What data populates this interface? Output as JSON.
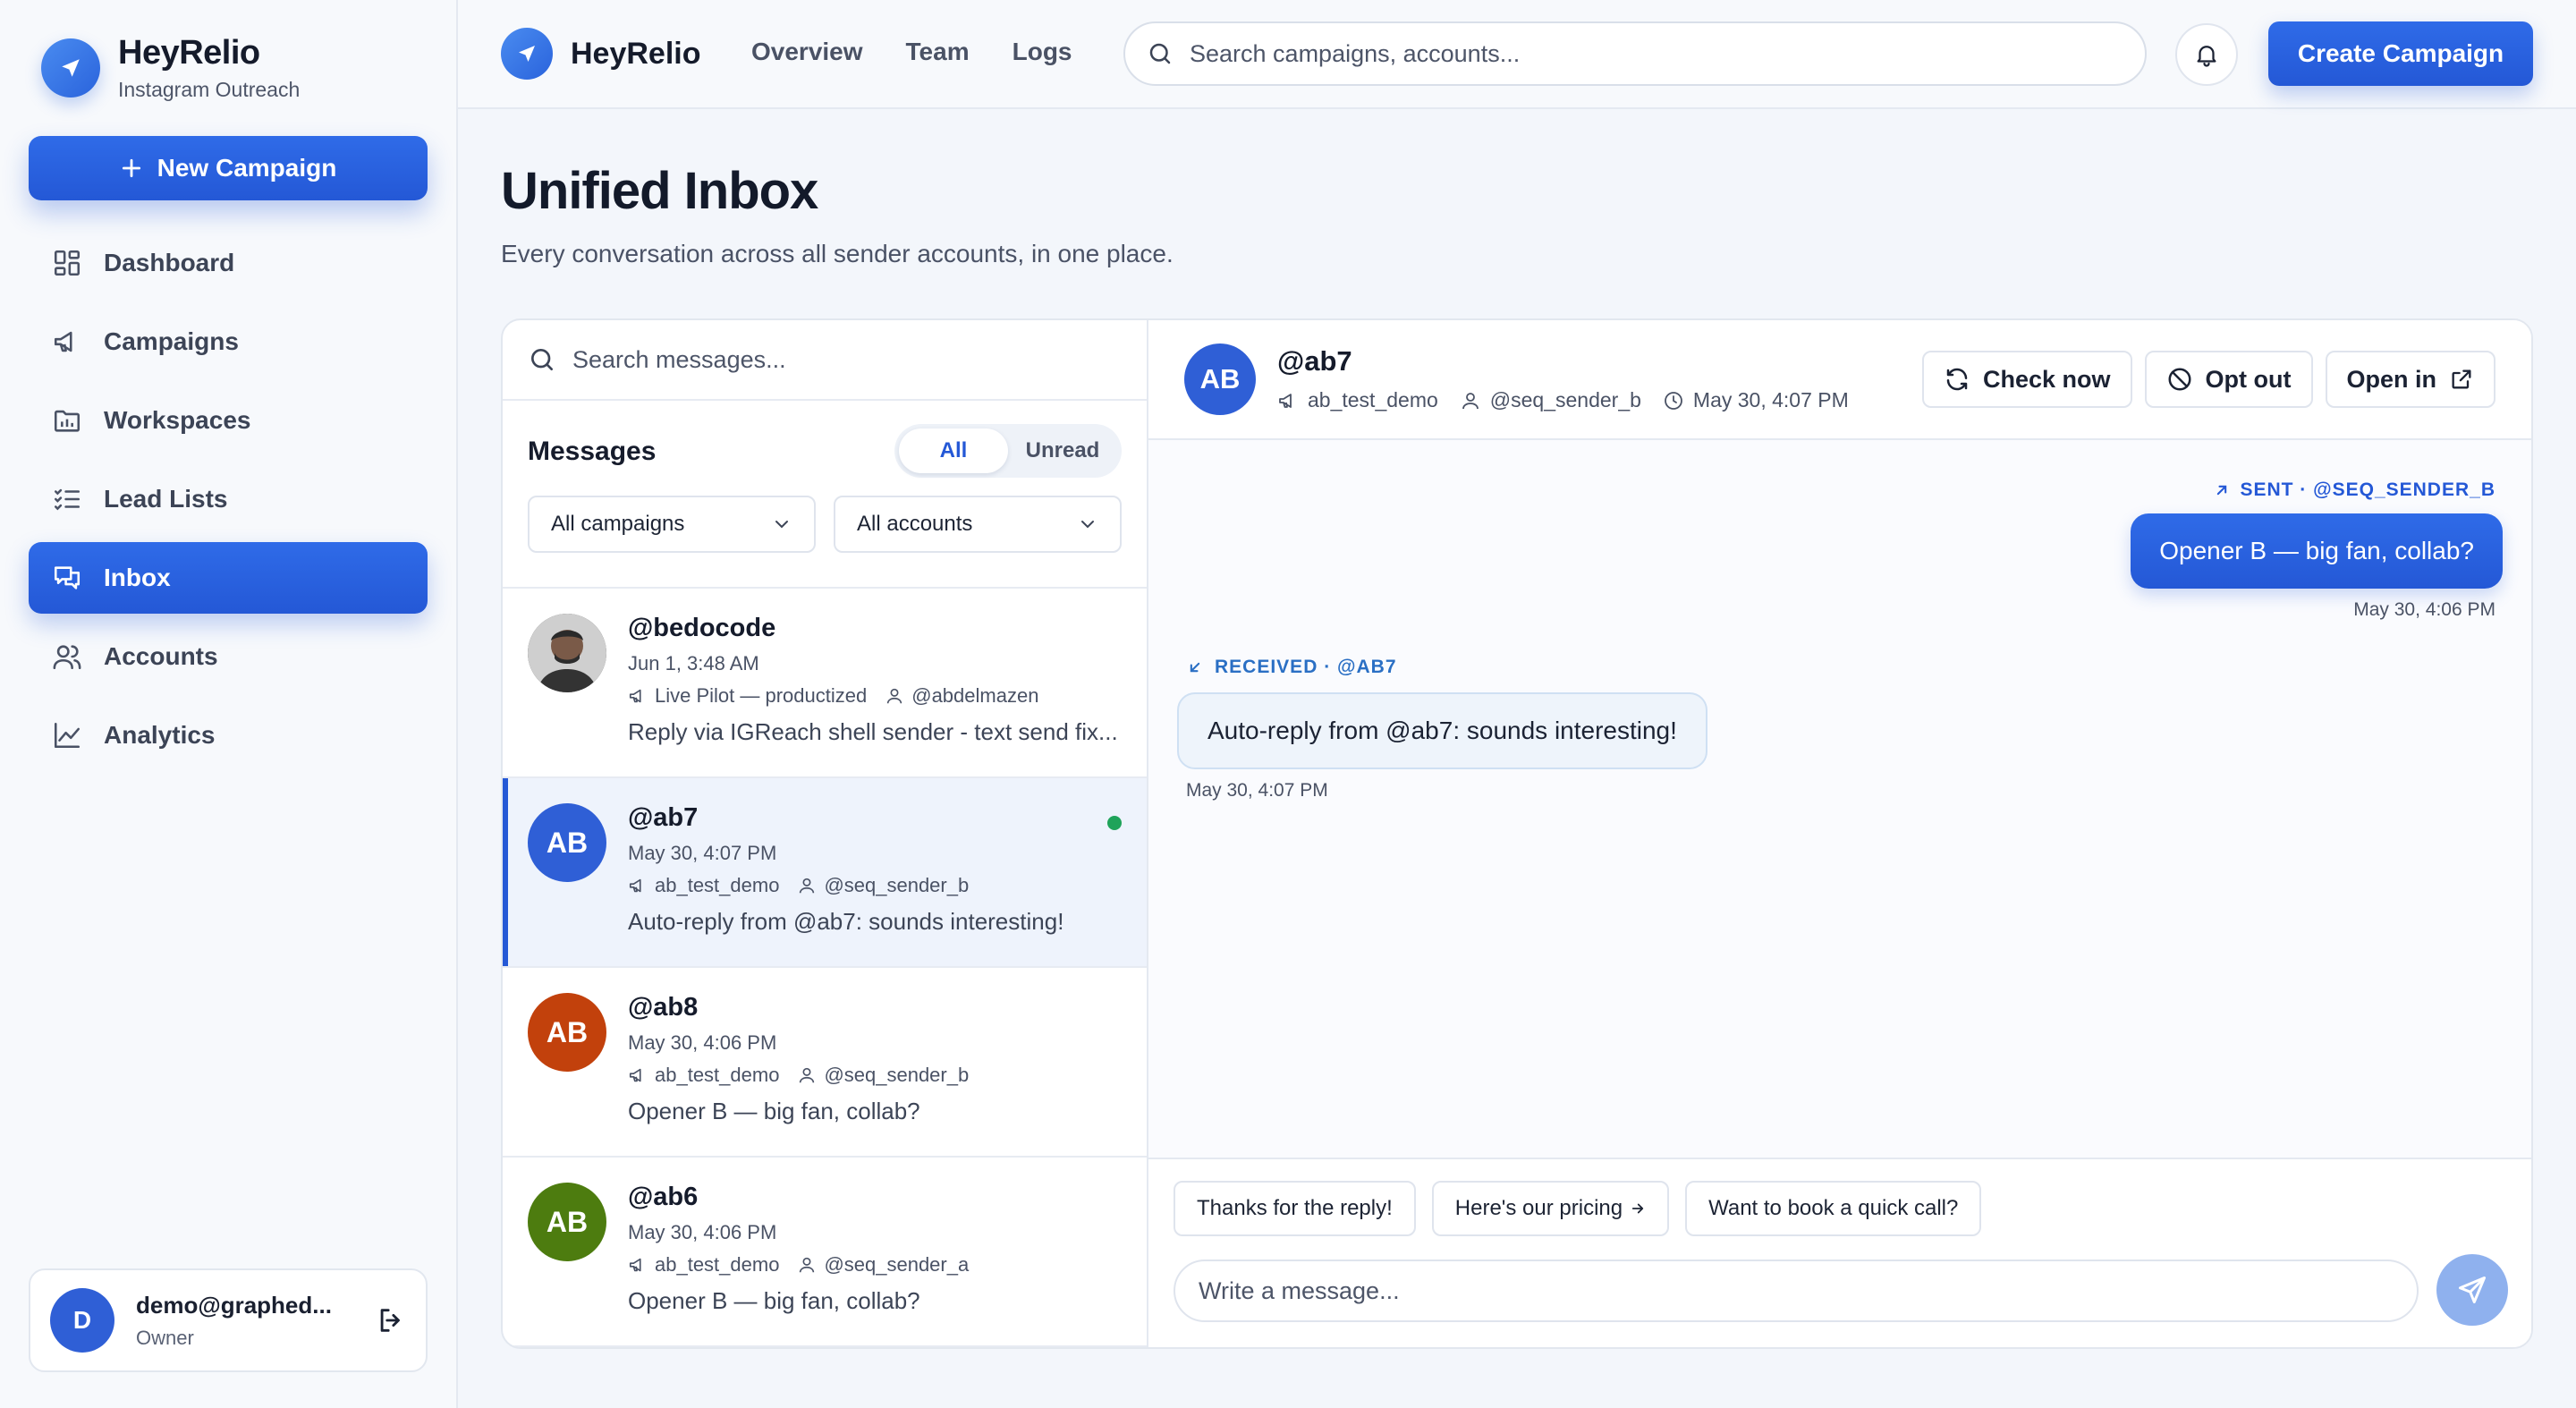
{
  "app": {
    "name": "HeyRelio",
    "tagline": "Instagram Outreach",
    "accent": "#2458d6"
  },
  "sidebar": {
    "new_campaign_label": "New Campaign",
    "items": [
      {
        "label": "Dashboard",
        "icon": "dashboard-icon",
        "active": false
      },
      {
        "label": "Campaigns",
        "icon": "megaphone-icon",
        "active": false
      },
      {
        "label": "Workspaces",
        "icon": "folder-icon",
        "active": false
      },
      {
        "label": "Lead Lists",
        "icon": "list-check-icon",
        "active": false
      },
      {
        "label": "Inbox",
        "icon": "chat-icon",
        "active": true
      },
      {
        "label": "Accounts",
        "icon": "users-icon",
        "active": false
      },
      {
        "label": "Analytics",
        "icon": "chart-line-icon",
        "active": false
      }
    ],
    "user": {
      "initial": "D",
      "email": "demo@graphed...",
      "role": "Owner"
    }
  },
  "topbar": {
    "brand": "HeyRelio",
    "links": [
      "Overview",
      "Team",
      "Logs"
    ],
    "search_placeholder": "Search campaigns, accounts...",
    "create_label": "Create Campaign"
  },
  "page": {
    "title": "Unified Inbox",
    "subtitle": "Every conversation across all sender accounts, in one place."
  },
  "inbox": {
    "search_placeholder": "Search messages...",
    "messages_title": "Messages",
    "filters": {
      "all": "All",
      "unread": "Unread",
      "active": "All"
    },
    "campaign_filter": "All campaigns",
    "account_filter": "All accounts",
    "conversations": [
      {
        "handle": "@bedocode",
        "initials": "",
        "photo": true,
        "time": "Jun 1, 3:48 AM",
        "campaign": "Live Pilot — productized",
        "sender": "@abdelmazen",
        "preview": "Reply via IGReach shell sender - text send fix...",
        "color": "#555555",
        "selected": false,
        "online": false
      },
      {
        "handle": "@ab7",
        "initials": "AB",
        "photo": false,
        "time": "May 30, 4:07 PM",
        "campaign": "ab_test_demo",
        "sender": "@seq_sender_b",
        "preview": "Auto-reply from @ab7: sounds interesting!",
        "color": "#2f5fd6",
        "selected": true,
        "online": true
      },
      {
        "handle": "@ab8",
        "initials": "AB",
        "photo": false,
        "time": "May 30, 4:06 PM",
        "campaign": "ab_test_demo",
        "sender": "@seq_sender_b",
        "preview": "Opener B — big fan, collab?",
        "color": "#c2410c",
        "selected": false,
        "online": false
      },
      {
        "handle": "@ab6",
        "initials": "AB",
        "photo": false,
        "time": "May 30, 4:06 PM",
        "campaign": "ab_test_demo",
        "sender": "@seq_sender_a",
        "preview": "Opener B — big fan, collab?",
        "color": "#4d7c0f",
        "selected": false,
        "online": false
      }
    ]
  },
  "thread": {
    "initials": "AB",
    "handle": "@ab7",
    "campaign": "ab_test_demo",
    "sender": "@seq_sender_b",
    "time": "May 30, 4:07 PM",
    "actions": {
      "check": "Check now",
      "opt_out": "Opt out",
      "open": "Open in"
    },
    "sent": {
      "label": "SENT · @SEQ_SENDER_B",
      "text": "Opener B — big fan, collab?",
      "time": "May 30, 4:06 PM"
    },
    "received": {
      "label": "RECEIVED · @AB7",
      "text": "Auto-reply from @ab7: sounds interesting!",
      "time": "May 30, 4:07 PM"
    },
    "quick_replies": [
      "Thanks for the reply!",
      "Here's our pricing",
      "Want to book a quick call?"
    ],
    "composer_placeholder": "Write a message..."
  }
}
